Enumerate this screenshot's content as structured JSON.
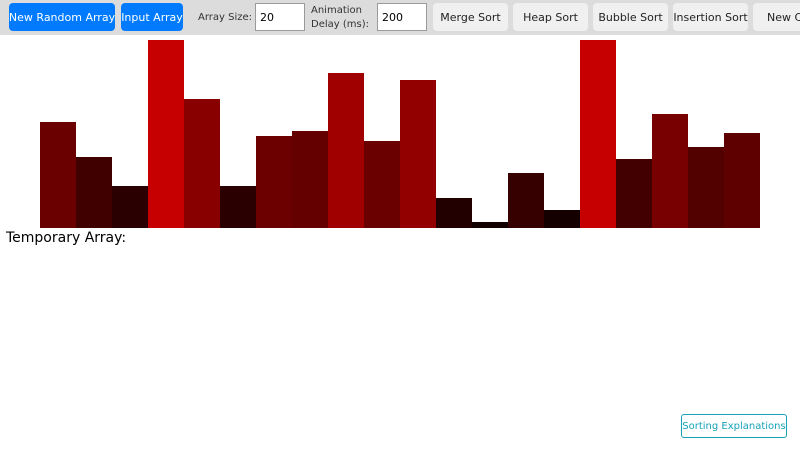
{
  "toolbar": {
    "new_random_array": "New Random Array",
    "input_array": "Input Array",
    "array_size_label": "Array Size:",
    "array_size_value": "20",
    "delay_label_line1": "Animation",
    "delay_label_line2": "Delay (ms):",
    "delay_value": "200",
    "merge_sort": "Merge Sort",
    "heap_sort": "Heap Sort",
    "bubble_sort": "Bubble Sort",
    "insertion_sort": "Insertion Sort",
    "cut_off_button": "New Co"
  },
  "array": {
    "values": [
      105,
      71,
      42,
      187,
      128,
      42,
      92,
      96,
      154,
      87,
      147,
      30,
      6,
      55,
      18,
      187,
      69,
      113,
      81,
      94
    ],
    "max": 187,
    "colors": [
      "#6b0000",
      "#400000",
      "#2a0000",
      "#c60000",
      "#890000",
      "#2b0000",
      "#6c0000",
      "#650000",
      "#a00000",
      "#6a0000",
      "#920000",
      "#220000",
      "#120000",
      "#360000",
      "#150000",
      "#c60000",
      "#430000",
      "#790000",
      "#530000",
      "#5f0000"
    ]
  },
  "temporary_array": {
    "label": "Temporary Array:",
    "values": []
  },
  "sorting_explanations": "Sorting Explanations"
}
